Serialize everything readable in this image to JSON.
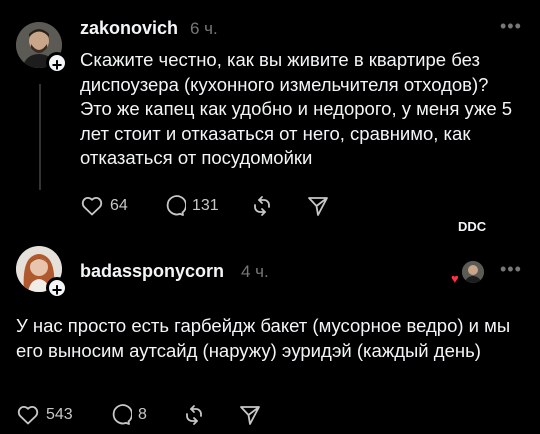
{
  "posts": [
    {
      "username": "zakonovich",
      "time": "6 ч.",
      "text": "Скажите честно, как вы живите в квартире без диспоузера (кухонного измельчителя отходов)? Это же капец как удобно и недорого, у меня уже 5 лет стоит и отказаться от него, сравнимо, как отказаться от посудомойки",
      "likes": "64",
      "comments": "131",
      "avatar_icon": "user-avatar-man",
      "more_icon": "more-dots-icon"
    },
    {
      "username": "badassponycorn",
      "time": "4 ч.",
      "text": "У нас просто есть гарбейдж бакет (мусорное ведро) и мы его выносим аутсайд (наружу) эуридэй (каждый день)",
      "likes": "543",
      "comments": "8",
      "avatar_icon": "user-avatar-woman",
      "more_icon": "more-dots-icon"
    }
  ],
  "watermark": "DDC",
  "colors": {
    "background": "#000000",
    "text": "#f3f5f7",
    "muted": "#777777",
    "heart": "#ff3040"
  }
}
